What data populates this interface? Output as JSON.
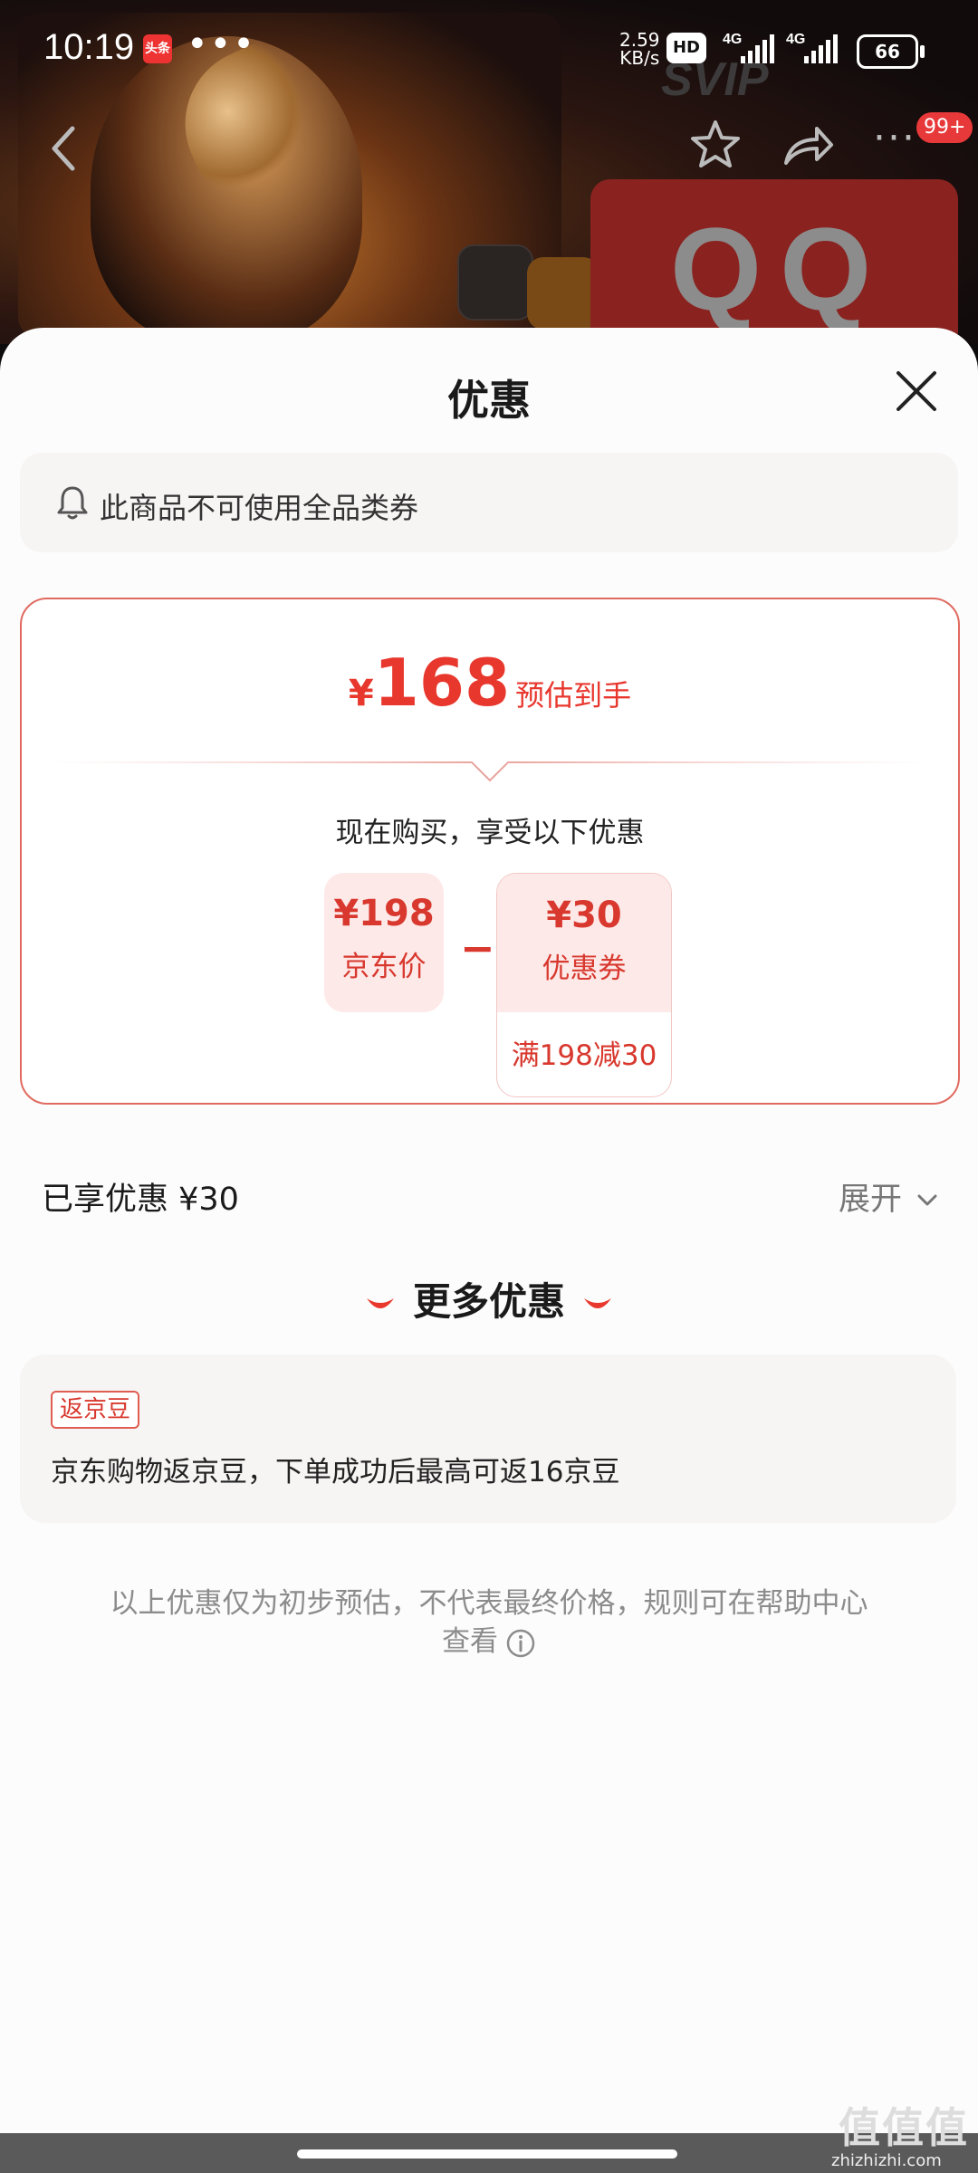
{
  "status_bar": {
    "time": "10:19",
    "news_badge": "头条",
    "more_dots": "•••",
    "speed_value": "2.59",
    "speed_unit": "KB/s",
    "hd_label": "HD",
    "signal_1_label": "4G",
    "signal_2_label": "4G",
    "battery": "66"
  },
  "background": {
    "svip_text": "SVIP",
    "qq_text": "QQ"
  },
  "nav": {
    "more_dots": "···",
    "message_badge": "99+"
  },
  "sheet": {
    "title": "优惠",
    "notice_text": "此商品不可使用全品类券",
    "estimate": {
      "currency": "¥",
      "amount": "168",
      "label": "预估到手"
    },
    "subtitle": "现在购买，享受以下优惠",
    "jd_price": {
      "value": "¥198",
      "label": "京东价"
    },
    "minus": "−",
    "coupon": {
      "value": "¥30",
      "label": "优惠券",
      "condition": "满198减30"
    },
    "enjoyed_text": "已享优惠 ¥30",
    "expand_label": "展开",
    "more_title": "更多优惠",
    "bean": {
      "tag": "返京豆",
      "text": "京东购物返京豆，下单成功后最高可返16京豆"
    },
    "disclaimer": "以上优惠仅为初步预估，不代表最终价格，规则可在帮助中心查看"
  },
  "watermark": {
    "main": "值值值",
    "sub": "zhizhizhi.com"
  },
  "colors": {
    "accent": "#e8372d",
    "pill_bg": "#fde9e8",
    "card_bg": "#f7f4f4"
  }
}
